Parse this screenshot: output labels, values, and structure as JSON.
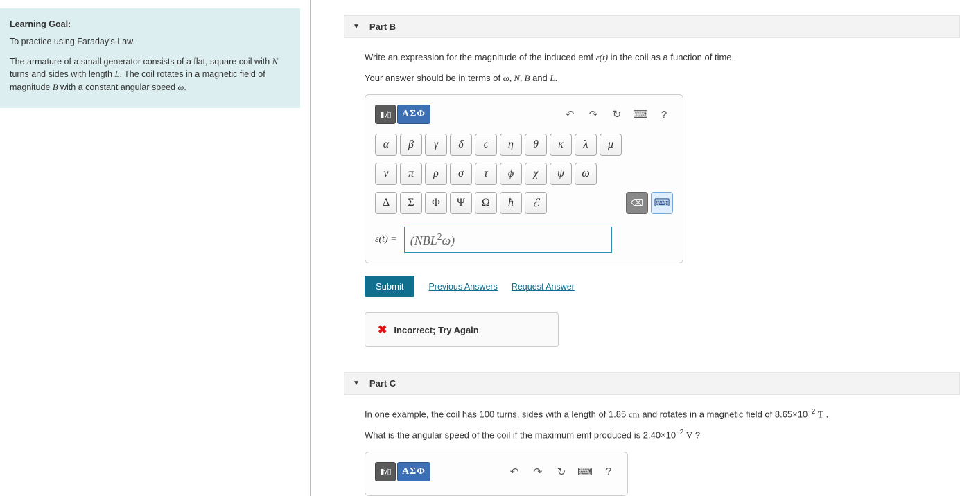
{
  "learning_goal": {
    "title": "Learning Goal:",
    "practice": "To practice using Faraday's Law.",
    "desc_pre": "The armature of a small generator consists of a flat, square coil with ",
    "var_N": "N",
    "desc_turns": " turns and sides with length ",
    "var_L": "L",
    "desc_mid": ". The coil rotates in a magnetic field of magnitude ",
    "var_B": "B",
    "desc_speed": " with a constant angular speed ",
    "var_omega": "ω",
    "desc_end": "."
  },
  "partB": {
    "title": "Part B",
    "instr1_pre": "Write an expression for the magnitude of the induced emf ",
    "instr1_emf": "ε(t)",
    "instr1_post": " in the coil as a function of time.",
    "instr2_pre": "Your answer should be in terms of ",
    "instr2_vars": "ω, N, B",
    "instr2_and": " and ",
    "instr2_L": "L",
    "instr2_end": ".",
    "answer_label": "ε(t) = ",
    "answer_value": "(NBL²ω)",
    "submit": "Submit",
    "prev_answers": "Previous Answers",
    "request_answer": "Request Answer",
    "feedback": "Incorrect; Try Again"
  },
  "partC": {
    "title": "Part C",
    "instr1": "In one example, the coil has 100 turns, sides with a length of 1.85 cm and rotates in a magnetic field of 8.65×10⁻² T .",
    "instr2": "What is the angular speed of the coil if the maximum emf produced is 2.40×10⁻² V ?"
  },
  "toolbar": {
    "template_label": "▮√▯",
    "greek_label": "ΑΣΦ",
    "help": "?"
  },
  "greek": {
    "row1": [
      "α",
      "β",
      "γ",
      "δ",
      "ϵ",
      "η",
      "θ",
      "κ",
      "λ",
      "μ"
    ],
    "row2": [
      "ν",
      "π",
      "ρ",
      "σ",
      "τ",
      "ϕ",
      "χ",
      "ψ",
      "ω"
    ],
    "row3": [
      "Δ",
      "Σ",
      "Φ",
      "Ψ",
      "Ω",
      "ħ",
      "ℰ"
    ]
  }
}
